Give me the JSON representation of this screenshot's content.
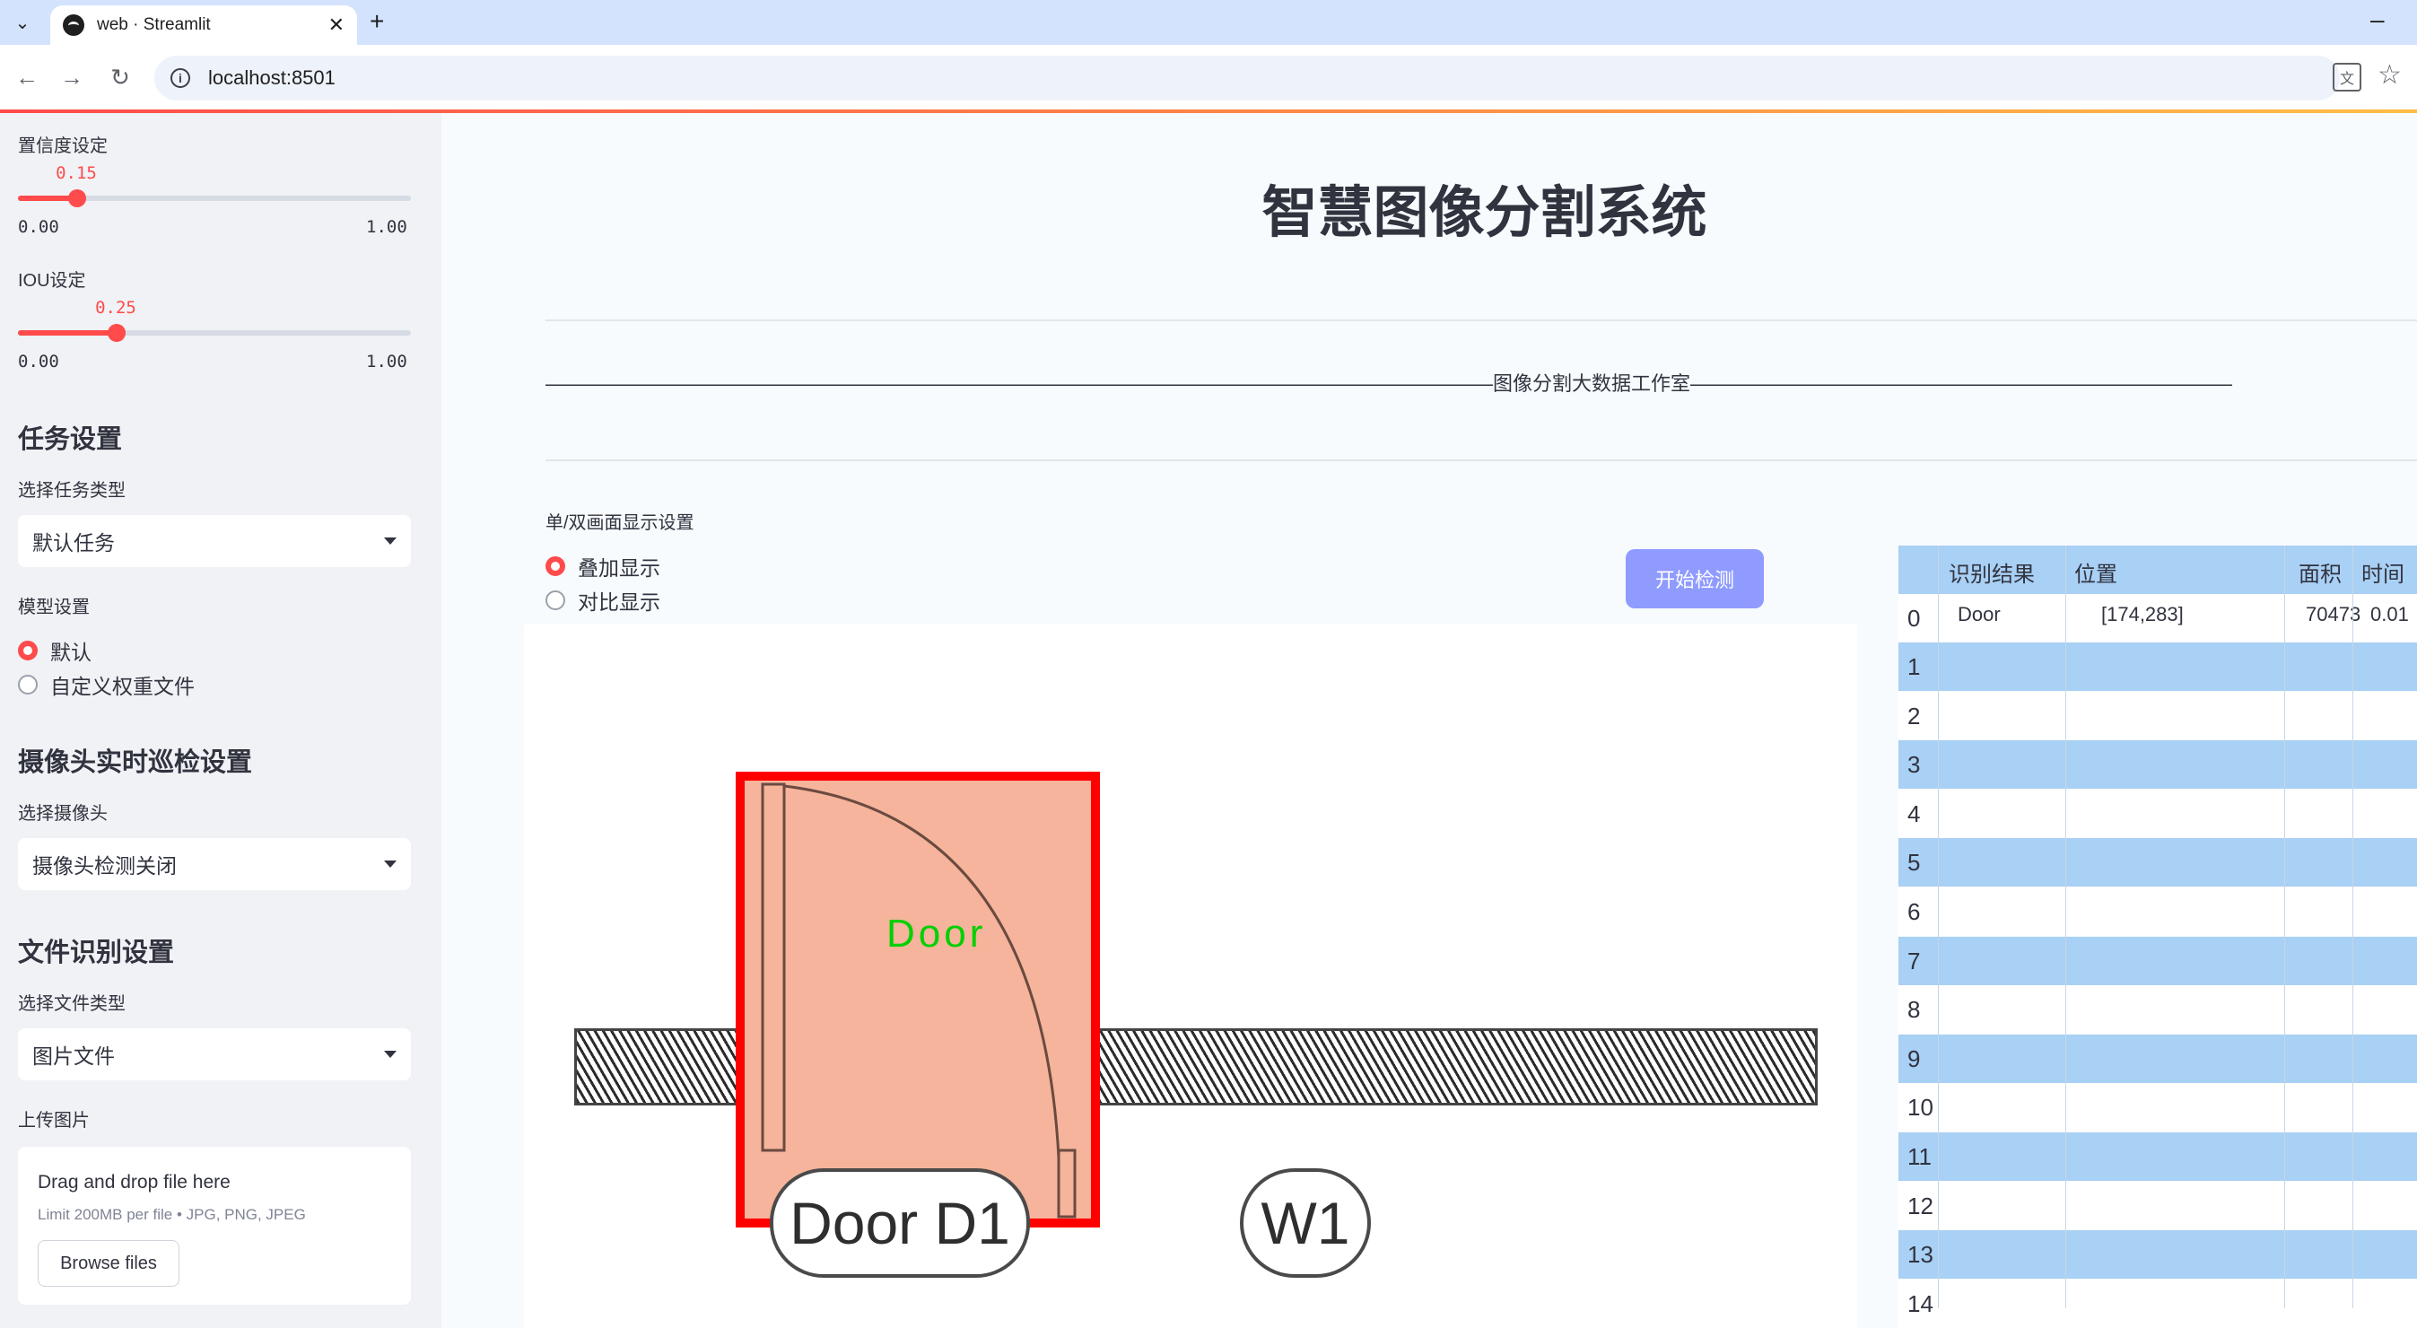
{
  "browser": {
    "tab_title": "web · Streamlit",
    "url": "localhost:8501"
  },
  "sidebar": {
    "confidence": {
      "label": "置信度设定",
      "value": "0.15",
      "min": "0.00",
      "max": "1.00",
      "fraction": 0.15
    },
    "iou": {
      "label": "IOU设定",
      "value": "0.25",
      "min": "0.00",
      "max": "1.00",
      "fraction": 0.25
    },
    "task_heading": "任务设置",
    "task_type_label": "选择任务类型",
    "task_type_value": "默认任务",
    "model_label": "模型设置",
    "model_options": [
      "默认",
      "自定义权重文件"
    ],
    "camera_heading": "摄像头实时巡检设置",
    "camera_label": "选择摄像头",
    "camera_value": "摄像头检测关闭",
    "file_heading": "文件识别设置",
    "file_type_label": "选择文件类型",
    "file_type_value": "图片文件",
    "upload_label": "上传图片",
    "upload_title": "Drag and drop file here",
    "upload_limit": "Limit 200MB per file • JPG, PNG, JPEG",
    "browse_label": "Browse files"
  },
  "main": {
    "title": "智慧图像分割系统",
    "studio_line": "————————————————————————————————————————————————图像分割大数据工作室————————————————————————————————————————————————",
    "display_label": "单/双画面显示设置",
    "display_options": [
      "叠加显示",
      "对比显示"
    ],
    "start_button": "开始检测",
    "image": {
      "detection_label": "Door",
      "door_tag": "Door D1",
      "window_tag": "W1"
    },
    "table": {
      "headers": [
        "识别结果",
        "位置",
        "面积",
        "时间"
      ],
      "first_row": {
        "index": "0",
        "result": "Door",
        "position": "[174,283]",
        "area": "70473",
        "time": "0.01"
      },
      "indices": [
        "1",
        "2",
        "3",
        "4",
        "5",
        "6",
        "7",
        "8",
        "9",
        "10",
        "11",
        "12",
        "13",
        "14"
      ]
    }
  },
  "colors": {
    "accent": "#ff4b4b",
    "button": "#8f9bff",
    "table_header": "#a9d0f5",
    "mask": "#f5b49b",
    "box": "#ff0000",
    "label_green": "#00d000"
  }
}
